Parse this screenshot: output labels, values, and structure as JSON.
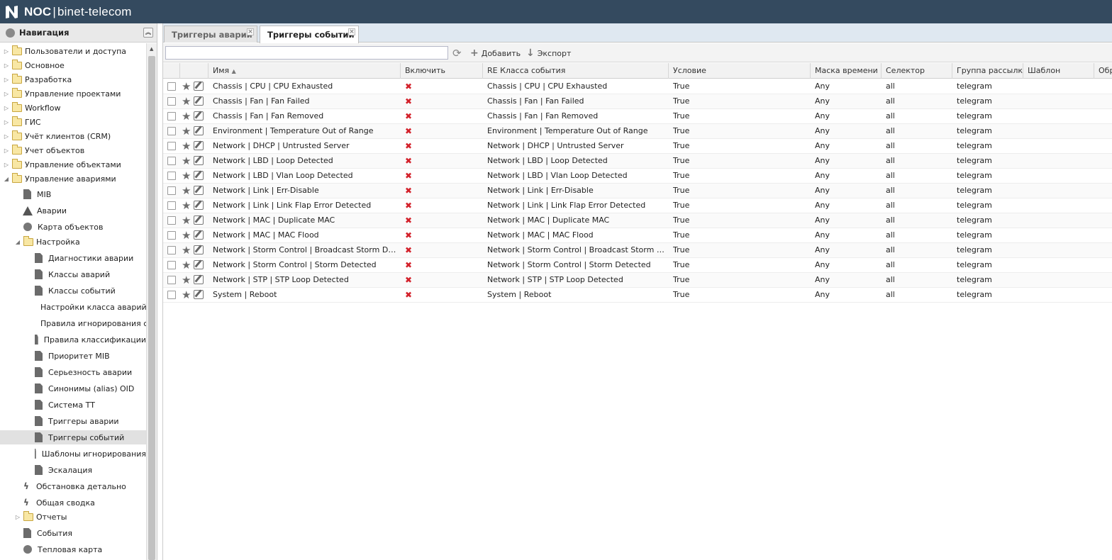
{
  "header": {
    "app": "NOC",
    "tenant": "binet-telecom"
  },
  "nav": {
    "title": "Навигация",
    "items": [
      {
        "label": "Пользователи и доступа",
        "kind": "folder",
        "arrow": "closed",
        "level": 0
      },
      {
        "label": "Основное",
        "kind": "folder",
        "arrow": "closed",
        "level": 0
      },
      {
        "label": "Разработка",
        "kind": "folder",
        "arrow": "closed",
        "level": 0
      },
      {
        "label": "Управление проектами",
        "kind": "folder",
        "arrow": "closed",
        "level": 0
      },
      {
        "label": "Workflow",
        "kind": "folder",
        "arrow": "closed",
        "level": 0
      },
      {
        "label": "ГИС",
        "kind": "folder",
        "arrow": "closed",
        "level": 0
      },
      {
        "label": "Учёт клиентов (CRM)",
        "kind": "folder",
        "arrow": "closed",
        "level": 0
      },
      {
        "label": "Учет объектов",
        "kind": "folder",
        "arrow": "closed",
        "level": 0
      },
      {
        "label": "Управление объектами",
        "kind": "folder",
        "arrow": "closed",
        "level": 0
      },
      {
        "label": "Управление авариями",
        "kind": "folder",
        "arrow": "open",
        "level": 0
      },
      {
        "label": "MIB",
        "kind": "doc",
        "level": 1
      },
      {
        "label": "Аварии",
        "kind": "warn",
        "level": 1
      },
      {
        "label": "Карта объектов",
        "kind": "globe",
        "level": 1
      },
      {
        "label": "Настройка",
        "kind": "folder",
        "arrow": "open",
        "level": 1
      },
      {
        "label": "Диагностики аварии",
        "kind": "doc",
        "level": 2
      },
      {
        "label": "Классы аварий",
        "kind": "doc",
        "level": 2
      },
      {
        "label": "Классы событий",
        "kind": "doc",
        "level": 2
      },
      {
        "label": "Настройки класса аварий",
        "kind": "doc",
        "level": 2
      },
      {
        "label": "Правила игнорирования со",
        "kind": "doc",
        "level": 2
      },
      {
        "label": "Правила классификации",
        "kind": "doc",
        "level": 2
      },
      {
        "label": "Приоритет MIB",
        "kind": "doc",
        "level": 2
      },
      {
        "label": "Серьезность аварии",
        "kind": "doc",
        "level": 2
      },
      {
        "label": "Синонимы (alias) OID",
        "kind": "doc",
        "level": 2
      },
      {
        "label": "Система ТТ",
        "kind": "doc",
        "level": 2
      },
      {
        "label": "Триггеры аварии",
        "kind": "doc",
        "level": 2
      },
      {
        "label": "Триггеры событий",
        "kind": "doc",
        "level": 2,
        "selected": true
      },
      {
        "label": "Шаблоны игнорирования",
        "kind": "doc",
        "level": 2
      },
      {
        "label": "Эскалация",
        "kind": "doc",
        "level": 2
      },
      {
        "label": "Обстановка детально",
        "kind": "bolt",
        "level": 1
      },
      {
        "label": "Общая сводка",
        "kind": "bolt",
        "level": 1
      },
      {
        "label": "Отчеты",
        "kind": "folder",
        "arrow": "closed",
        "level": 1
      },
      {
        "label": "События",
        "kind": "doc",
        "level": 1
      },
      {
        "label": "Тепловая карта",
        "kind": "globe",
        "level": 1
      }
    ]
  },
  "tabs": [
    {
      "label": "Триггеры аварии",
      "active": false
    },
    {
      "label": "Триггеры событий",
      "active": true
    }
  ],
  "toolbar": {
    "search_value": "",
    "add_label": "Добавить",
    "export_label": "Экспорт"
  },
  "columns": [
    "Имя",
    "Включить",
    "RE Класса события",
    "Условие",
    "Маска времени",
    "Селектор",
    "Группа рассылки",
    "Шаблон",
    "Обр"
  ],
  "sort_indicator": "▲",
  "enabled_mark": "✖",
  "rows": [
    {
      "name": "Chassis | CPU | CPU Exhausted",
      "re": "Chassis | CPU | CPU Exhausted",
      "cond": "True",
      "mask": "Any",
      "sel": "all",
      "group": "telegram"
    },
    {
      "name": "Chassis | Fan | Fan Failed",
      "re": "Chassis | Fan | Fan Failed",
      "cond": "True",
      "mask": "Any",
      "sel": "all",
      "group": "telegram"
    },
    {
      "name": "Chassis | Fan | Fan Removed",
      "re": "Chassis | Fan | Fan Removed",
      "cond": "True",
      "mask": "Any",
      "sel": "all",
      "group": "telegram"
    },
    {
      "name": "Environment | Temperature Out of Range",
      "re": "Environment | Temperature Out of Range",
      "cond": "True",
      "mask": "Any",
      "sel": "all",
      "group": "telegram"
    },
    {
      "name": "Network | DHCP | Untrusted Server",
      "re": "Network | DHCP | Untrusted Server",
      "cond": "True",
      "mask": "Any",
      "sel": "all",
      "group": "telegram"
    },
    {
      "name": "Network | LBD | Loop Detected",
      "re": "Network | LBD | Loop Detected",
      "cond": "True",
      "mask": "Any",
      "sel": "all",
      "group": "telegram"
    },
    {
      "name": "Network | LBD | Vlan Loop Detected",
      "re": "Network | LBD | Vlan Loop Detected",
      "cond": "True",
      "mask": "Any",
      "sel": "all",
      "group": "telegram"
    },
    {
      "name": "Network | Link | Err-Disable",
      "re": "Network | Link | Err-Disable",
      "cond": "True",
      "mask": "Any",
      "sel": "all",
      "group": "telegram"
    },
    {
      "name": "Network | Link | Link Flap Error Detected",
      "re": "Network | Link | Link Flap Error Detected",
      "cond": "True",
      "mask": "Any",
      "sel": "all",
      "group": "telegram"
    },
    {
      "name": "Network | MAC | Duplicate MAC",
      "re": "Network | MAC | Duplicate MAC",
      "cond": "True",
      "mask": "Any",
      "sel": "all",
      "group": "telegram"
    },
    {
      "name": "Network | MAC | MAC Flood",
      "re": "Network | MAC | MAC Flood",
      "cond": "True",
      "mask": "Any",
      "sel": "all",
      "group": "telegram"
    },
    {
      "name": "Network | Storm Control | Broadcast Storm Detected",
      "re": "Network | Storm Control | Broadcast Storm Dete...",
      "cond": "True",
      "mask": "Any",
      "sel": "all",
      "group": "telegram"
    },
    {
      "name": "Network | Storm Control | Storm Detected",
      "re": "Network | Storm Control | Storm Detected",
      "cond": "True",
      "mask": "Any",
      "sel": "all",
      "group": "telegram"
    },
    {
      "name": "Network | STP | STP Loop Detected",
      "re": "Network | STP | STP Loop Detected",
      "cond": "True",
      "mask": "Any",
      "sel": "all",
      "group": "telegram"
    },
    {
      "name": "System | Reboot",
      "re": "System | Reboot",
      "cond": "True",
      "mask": "Any",
      "sel": "all",
      "group": "telegram"
    }
  ]
}
